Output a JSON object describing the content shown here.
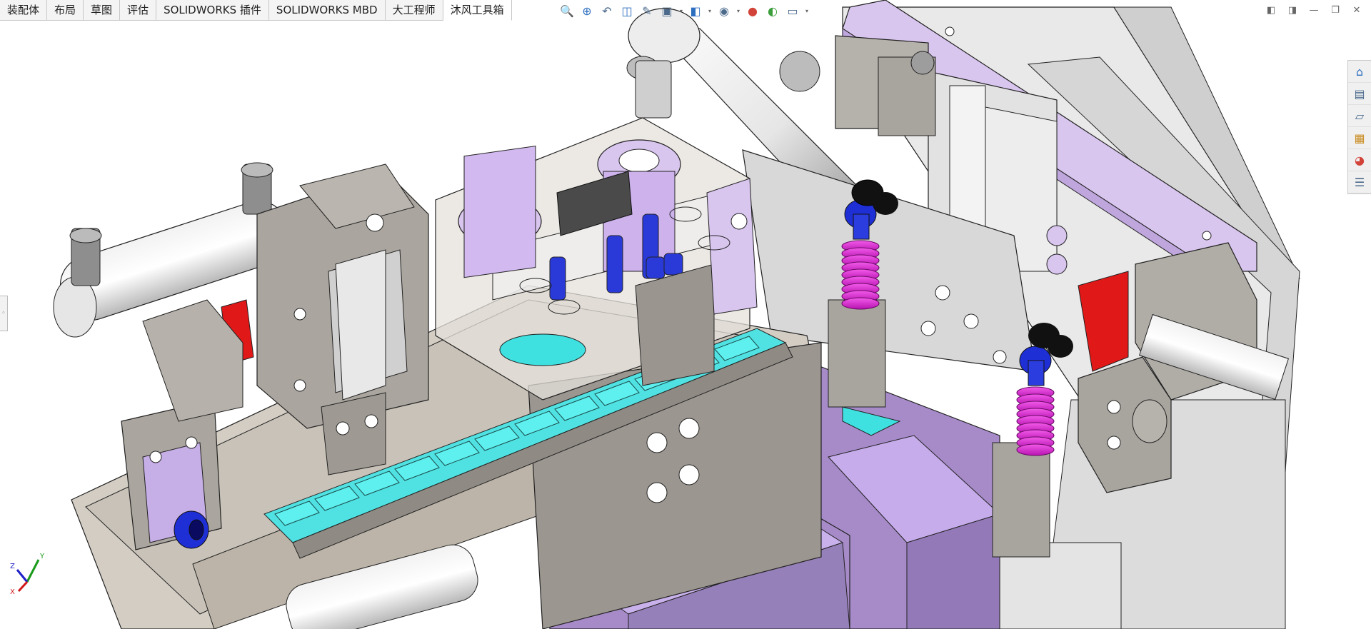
{
  "tabs": [
    {
      "label": "装配体",
      "active": false
    },
    {
      "label": "布局",
      "active": false
    },
    {
      "label": "草图",
      "active": false
    },
    {
      "label": "评估",
      "active": false
    },
    {
      "label": "SOLIDWORKS 插件",
      "active": false
    },
    {
      "label": "SOLIDWORKS MBD",
      "active": false
    },
    {
      "label": "大工程师",
      "active": false
    },
    {
      "label": "沐风工具箱",
      "active": true
    }
  ],
  "headsup_toolbar": {
    "icons": [
      "zoom-to-fit-icon",
      "zoom-to-area-icon",
      "previous-view-icon",
      "section-view-icon",
      "dynamic-annotation-icon",
      "view-orientation-icon",
      "display-style-icon",
      "hide-show-items-icon",
      "edit-appearance-icon",
      "apply-scene-icon",
      "view-settings-icon"
    ]
  },
  "window_controls": {
    "icons": [
      "tile-left-icon",
      "tile-right-icon",
      "minimize-icon",
      "restore-icon",
      "close-icon"
    ]
  },
  "task_pane": {
    "icons": [
      "home-icon",
      "design-library-icon",
      "file-explorer-icon",
      "view-palette-icon",
      "appearances-icon",
      "custom-properties-icon"
    ]
  },
  "triad": {
    "x_label": "X",
    "y_label": "Y",
    "z_label": "Z"
  },
  "colors": {
    "metal_gray": "#a8a49e",
    "cyan_plate": "#3fe0e0",
    "purple_bin": "#a78bc9",
    "lavender": "#d9c6ef",
    "magenta_spring": "#e02fd8",
    "blue_fitting": "#1e2fd6",
    "red_block": "#e01818"
  }
}
